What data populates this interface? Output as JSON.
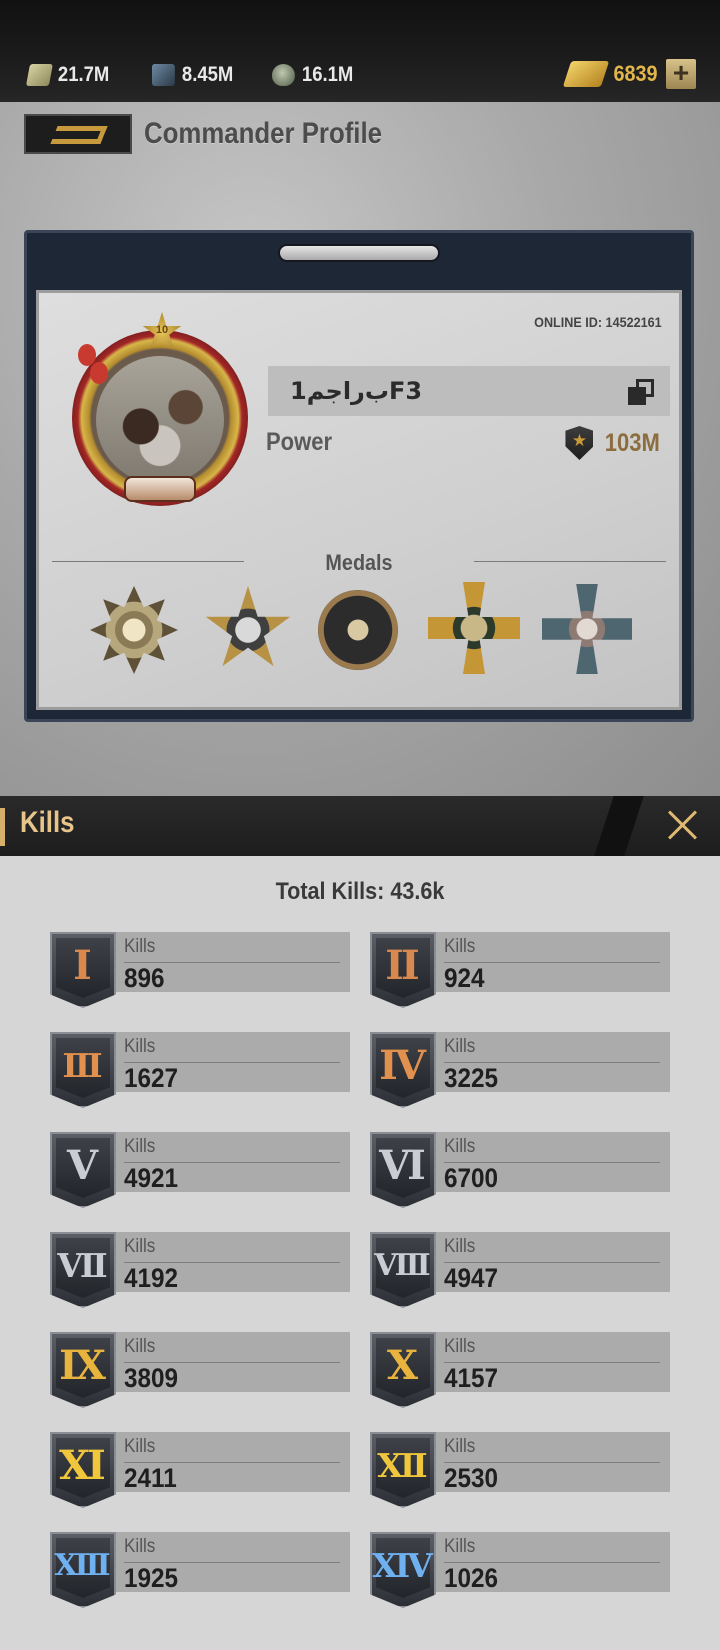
{
  "resources": {
    "cash": "21.7M",
    "steel": "8.45M",
    "oil": "16.1M",
    "gold": "6839",
    "add_label": "+"
  },
  "header": {
    "title": "Commander Profile"
  },
  "profile": {
    "online_id": "ONLINE ID: 14522161",
    "avatar_level": "10",
    "name": "ب‌راجم1F3",
    "power_label": "Power",
    "power_value": "103M",
    "medals_title": "Medals",
    "medals": [
      "medal-1",
      "medal-2",
      "medal-3",
      "medal-4",
      "medal-5"
    ]
  },
  "kills": {
    "title": "Kills",
    "total": "Total Kills: 43.6k",
    "item_label": "Kills",
    "tiers": [
      {
        "rank": "I",
        "value": "896",
        "color": "#d9884e"
      },
      {
        "rank": "II",
        "value": "924",
        "color": "#d9884e"
      },
      {
        "rank": "III",
        "value": "1627",
        "color": "#e2904d"
      },
      {
        "rank": "IV",
        "value": "3225",
        "color": "#e2904d"
      },
      {
        "rank": "V",
        "value": "4921",
        "color": "#c9ccd2"
      },
      {
        "rank": "VI",
        "value": "6700",
        "color": "#c9ccd2"
      },
      {
        "rank": "VII",
        "value": "4192",
        "color": "#c9ccd2"
      },
      {
        "rank": "VIII",
        "value": "4947",
        "color": "#c9ccd2"
      },
      {
        "rank": "IX",
        "value": "3809",
        "color": "#e8b43e"
      },
      {
        "rank": "X",
        "value": "4157",
        "color": "#e8b43e"
      },
      {
        "rank": "XI",
        "value": "2411",
        "color": "#efc63c"
      },
      {
        "rank": "XII",
        "value": "2530",
        "color": "#efc63c"
      },
      {
        "rank": "XIII",
        "value": "1925",
        "color": "#6fb0f0"
      },
      {
        "rank": "XIV",
        "value": "1026",
        "color": "#6fb0f0"
      }
    ]
  }
}
